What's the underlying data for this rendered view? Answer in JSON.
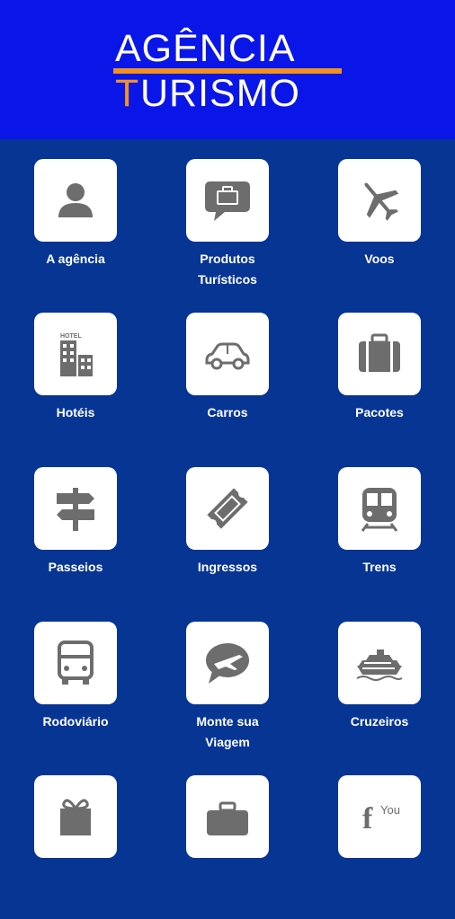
{
  "logo": {
    "line1": "AGÊNCIA",
    "line2_first": "T",
    "line2_rest": "URISMO"
  },
  "tiles": [
    {
      "label": "A agência",
      "icon": "person-icon"
    },
    {
      "label": "Produtos\nTurísticos",
      "icon": "luggage-chat-icon"
    },
    {
      "label": "Voos",
      "icon": "airplane-icon"
    },
    {
      "label": "Hotéis",
      "icon": "hotel-building-icon"
    },
    {
      "label": "Carros",
      "icon": "car-icon"
    },
    {
      "label": "Pacotes",
      "icon": "suitcase-icon"
    },
    {
      "label": "Passeios",
      "icon": "signpost-icon"
    },
    {
      "label": "Ingressos",
      "icon": "ticket-icon"
    },
    {
      "label": "Trens",
      "icon": "train-icon"
    },
    {
      "label": "Rodoviário",
      "icon": "bus-icon"
    },
    {
      "label": "Monte sua\nViagem",
      "icon": "plane-chat-icon"
    },
    {
      "label": "Cruzeiros",
      "icon": "ship-icon"
    }
  ],
  "colors": {
    "header": "#0A16E8",
    "background": "#073594",
    "accent": "#F2921E",
    "icon": "#6d6d6d"
  }
}
